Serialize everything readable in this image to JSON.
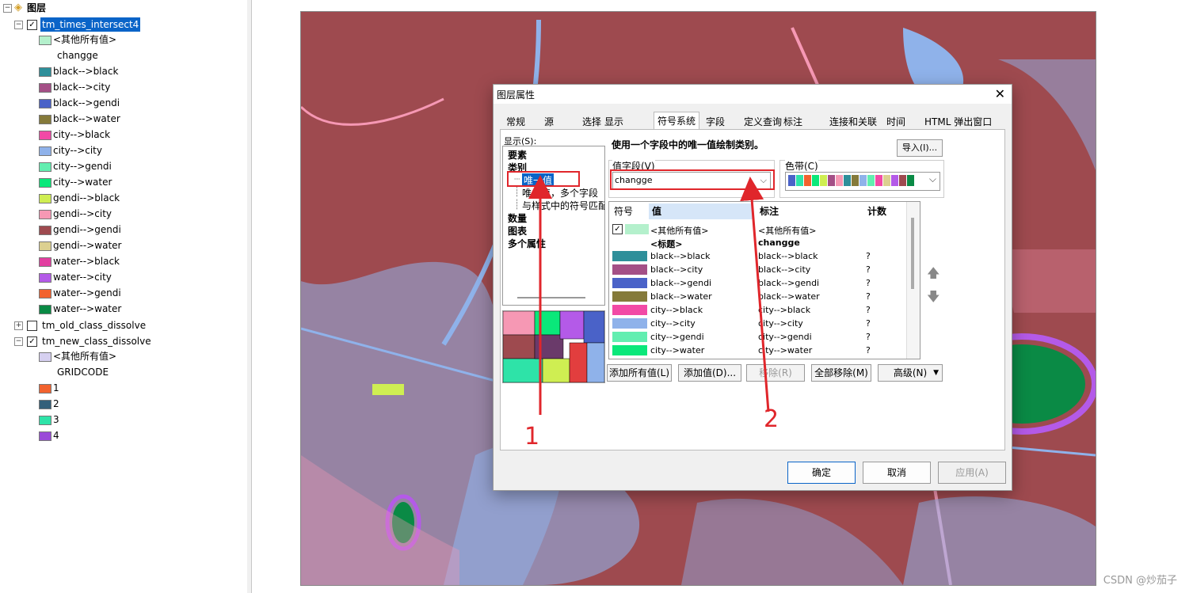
{
  "toc": {
    "root_label": "图层",
    "layer1": {
      "name": "tm_times_intersect4",
      "checked": true,
      "other": "<其他所有值>",
      "field": "changge",
      "classes": [
        {
          "label": "black-->black",
          "color": "#2e8f9a"
        },
        {
          "label": "black-->city",
          "color": "#a44f86"
        },
        {
          "label": "black-->gendi",
          "color": "#4a62c8"
        },
        {
          "label": "black-->water",
          "color": "#857a3a"
        },
        {
          "label": "city-->black",
          "color": "#f24aa6"
        },
        {
          "label": "city-->city",
          "color": "#8fb2ea"
        },
        {
          "label": "city-->gendi",
          "color": "#62eeb0"
        },
        {
          "label": "city-->water",
          "color": "#0ae87a"
        },
        {
          "label": "gendi-->black",
          "color": "#cfee52"
        },
        {
          "label": "gendi-->city",
          "color": "#f698b4"
        },
        {
          "label": "gendi-->gendi",
          "color": "#9e4a4f"
        },
        {
          "label": "gendi-->water",
          "color": "#dcd090"
        },
        {
          "label": "water-->black",
          "color": "#e23ea0"
        },
        {
          "label": "water-->city",
          "color": "#b45ae8"
        },
        {
          "label": "water-->gendi",
          "color": "#f2622e"
        },
        {
          "label": "water-->water",
          "color": "#0a8a45"
        }
      ]
    },
    "layer2": {
      "name": "tm_old_class_dissolve",
      "checked": false
    },
    "layer3": {
      "name": "tm_new_class_dissolve",
      "checked": true,
      "other": "<其他所有值>",
      "field": "GRIDCODE",
      "classes": [
        {
          "label": "1",
          "color": "#f2622e"
        },
        {
          "label": "2",
          "color": "#33607a"
        },
        {
          "label": "3",
          "color": "#2ee3a8"
        },
        {
          "label": "4",
          "color": "#9a4ad8"
        }
      ]
    }
  },
  "dialog": {
    "title": "图层属性",
    "tabs": [
      "常规",
      "源",
      "选择",
      "显示",
      "符号系统",
      "字段",
      "定义查询",
      "标注",
      "连接和关联",
      "时间",
      "HTML 弹出窗口"
    ],
    "active_tab": "符号系统",
    "show_label": "显示(S):",
    "tree": {
      "features": "要素",
      "categories": "类别",
      "unique": "唯一值",
      "unique_multi": "唯一值，多个字段",
      "match_style": "与样式中的符号匹配",
      "quantities": "数量",
      "charts": "图表",
      "multi_attr": "多个属性"
    },
    "description": "使用一个字段中的唯一值绘制类别。",
    "import_label": "导入(I)...",
    "value_field_label": "值字段(V)",
    "value_field": "changge",
    "color_ramp_label": "色带(C)",
    "ramp_colors": [
      "#4a62c8",
      "#2ee3a8",
      "#f2622e",
      "#0ae87a",
      "#cfee52",
      "#a44f86",
      "#f698b4",
      "#2e8f9a",
      "#857a3a",
      "#8fb2ea",
      "#62eeb0",
      "#f24aa6",
      "#dcd090",
      "#b45ae8",
      "#9e4a4f",
      "#0a8a45"
    ],
    "grid": {
      "headers": {
        "symbol": "符号",
        "value": "值",
        "label": "标注",
        "count": "计数"
      },
      "other_row": {
        "value": "<其他所有值>",
        "label": "<其他所有值>",
        "color": "#b4f0cc"
      },
      "heading_row": {
        "value": "<标题>",
        "label": "changge"
      },
      "rows": [
        {
          "value": "black-->black",
          "label": "black-->black",
          "count": "?",
          "color": "#2e8f9a"
        },
        {
          "value": "black-->city",
          "label": "black-->city",
          "count": "?",
          "color": "#a44f86"
        },
        {
          "value": "black-->gendi",
          "label": "black-->gendi",
          "count": "?",
          "color": "#4a62c8"
        },
        {
          "value": "black-->water",
          "label": "black-->water",
          "count": "?",
          "color": "#857a3a"
        },
        {
          "value": "city-->black",
          "label": "city-->black",
          "count": "?",
          "color": "#f24aa6"
        },
        {
          "value": "city-->city",
          "label": "city-->city",
          "count": "?",
          "color": "#8fb2ea"
        },
        {
          "value": "city-->gendi",
          "label": "city-->gendi",
          "count": "?",
          "color": "#62eeb0"
        },
        {
          "value": "city-->water",
          "label": "city-->water",
          "count": "?",
          "color": "#0ae87a"
        }
      ]
    },
    "buttons": {
      "add_all": "添加所有值(L)",
      "add_values": "添加值(D)...",
      "remove": "移除(R)",
      "remove_all": "全部移除(M)",
      "advanced": "高级(N)"
    },
    "ok": "确定",
    "cancel": "取消",
    "apply": "应用(A)"
  },
  "annotations": {
    "one": "1",
    "two": "2"
  },
  "watermark": "CSDN @炒茄子"
}
